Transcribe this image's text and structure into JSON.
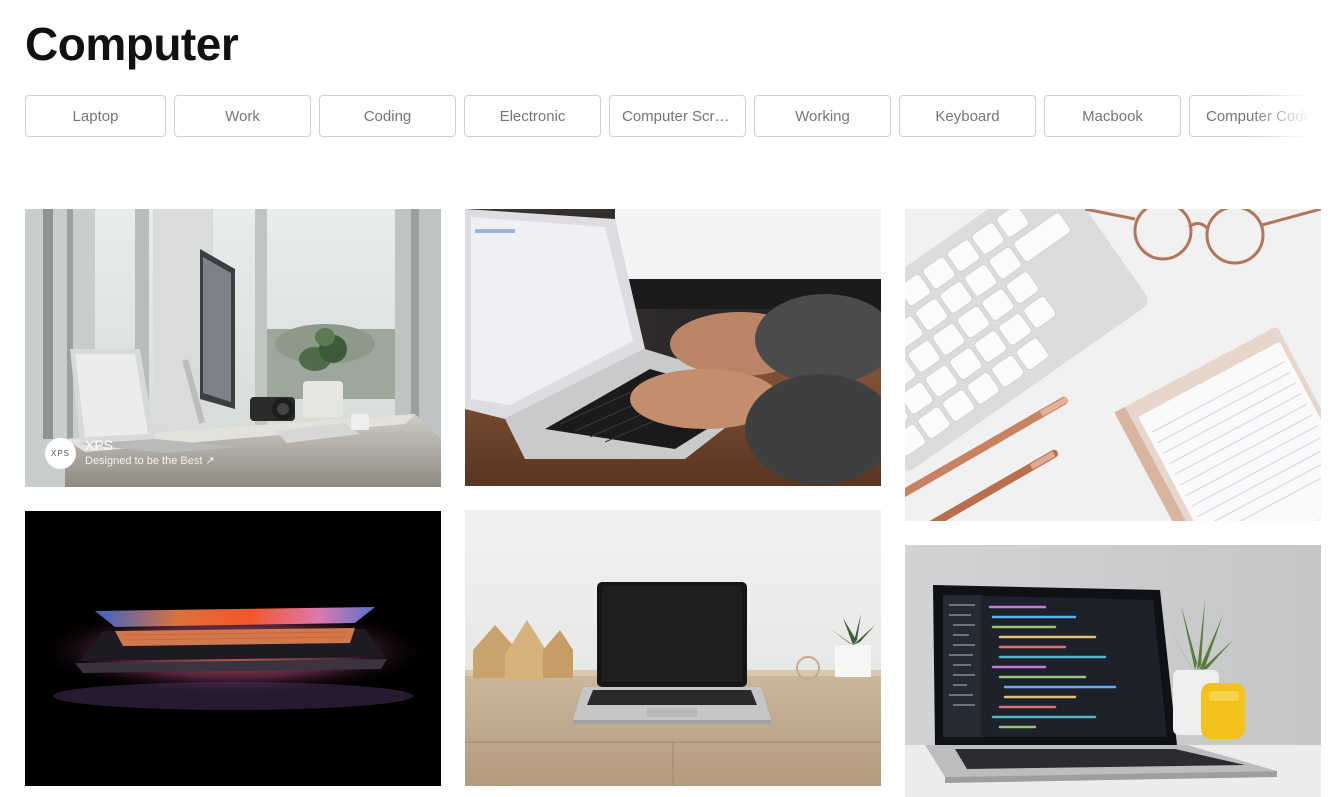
{
  "page": {
    "title": "Computer"
  },
  "related_searches": [
    {
      "label": "Laptop"
    },
    {
      "label": "Work"
    },
    {
      "label": "Coding"
    },
    {
      "label": "Electronic"
    },
    {
      "label": "Computer Screen"
    },
    {
      "label": "Working"
    },
    {
      "label": "Keyboard"
    },
    {
      "label": "Macbook"
    },
    {
      "label": "Computer Code"
    }
  ],
  "photos": [
    {
      "subject": "laptop-and-monitor-desk-by-window",
      "sponsored": true
    },
    {
      "subject": "hands-typing-on-laptop"
    },
    {
      "subject": "white-keyboard-with-glasses-and-pens"
    },
    {
      "subject": "glowing-laptop-in-dark"
    },
    {
      "subject": "laptop-on-wooden-desk"
    },
    {
      "subject": "laptop-showing-code"
    }
  ],
  "sponsor": {
    "logo_text": "XPS",
    "name": "XPS",
    "tagline": "Designed to be the Best",
    "link_icon": "external-arrow-icon"
  },
  "colors": {
    "chip_border": "#cfcfcf",
    "chip_text": "#767676",
    "title_text": "#111111"
  }
}
